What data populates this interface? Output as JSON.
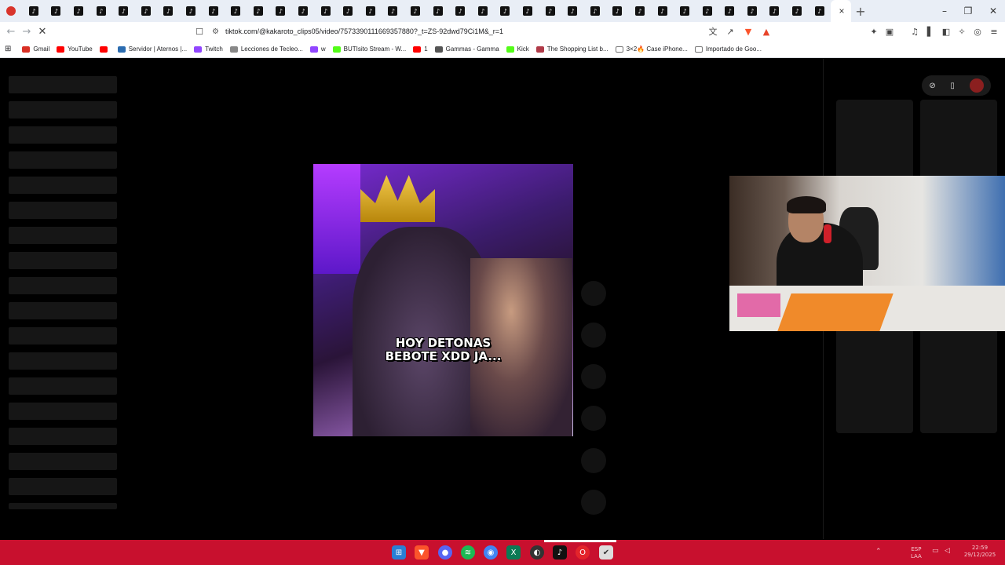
{
  "browser": {
    "tab_count": 38,
    "tab_favicon_glyph": "♪",
    "active_tab_close": "×",
    "new_tab": "+",
    "window_controls": [
      "–",
      "❐",
      "✕"
    ],
    "url": "tiktok.com/@kakaroto_clips05/video/7573390111669357880?_t=ZS-92dwd79Ci1M&_r=1",
    "back": "←",
    "forward": "→",
    "reload": "✕",
    "bookmarks": [
      {
        "label": "Gmail",
        "color": "#d93025"
      },
      {
        "label": "YouTube",
        "color": "#ff0000"
      },
      {
        "label": "",
        "color": "#ff0000"
      },
      {
        "label": "Servidor | Aternos |...",
        "color": "#2b6cb0"
      },
      {
        "label": "Twitch",
        "color": "#9146ff"
      },
      {
        "label": "Lecciones de Tecleo...",
        "color": "#888888"
      },
      {
        "label": "w",
        "color": "#9146ff"
      },
      {
        "label": "BUTIsito Stream - W...",
        "color": "#53fc18"
      },
      {
        "label": "1",
        "color": "#ff0000"
      },
      {
        "label": "Gammas - Gamma",
        "color": "#555555"
      },
      {
        "label": "Kick",
        "color": "#53fc18"
      },
      {
        "label": "The Shopping List b...",
        "color": "#b03a48"
      },
      {
        "label": "3×2🔥 Case iPhone...",
        "color": "#ffffff"
      },
      {
        "label": "Importado de Goo...",
        "color": "#ffffff"
      }
    ]
  },
  "video": {
    "caption_line1": "HOY DETONAS",
    "caption_line2": "BEBOTE XDD JA..."
  },
  "taskbar": {
    "lang_line1": "ESP",
    "lang_line2": "LAA",
    "time": "22:59",
    "date": "29/12/2025"
  },
  "colors": {
    "taskbar": "#c8102e",
    "page_background": "#000000"
  }
}
